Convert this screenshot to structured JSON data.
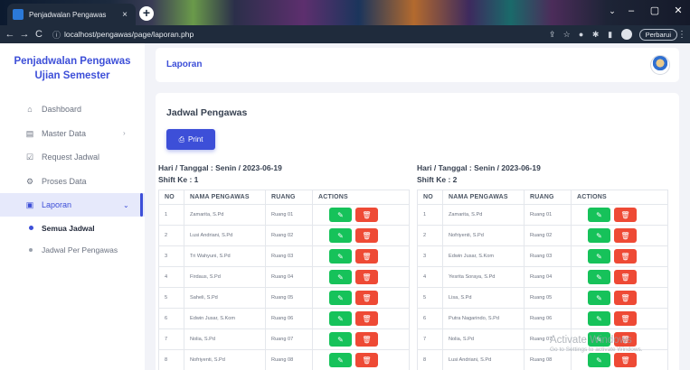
{
  "browser": {
    "tab_title": "Penjadwalan Pengawas",
    "tab_close": "×",
    "new_tab": "+",
    "url": "localhost/pengawas/page/laporan.php",
    "update_label": "Perbarui",
    "window_controls": [
      "⌄",
      "–",
      "▢",
      "✕"
    ]
  },
  "sidebar": {
    "brand": "Penjadwalan Pengawas Ujian Semester",
    "items": [
      {
        "label": "Dashboard",
        "icon": "home-icon"
      },
      {
        "label": "Master Data",
        "icon": "database-icon",
        "chevron": "›"
      },
      {
        "label": "Request Jadwal",
        "icon": "edit-square-icon"
      },
      {
        "label": "Proses Data",
        "icon": "gear-icon"
      },
      {
        "label": "Laporan",
        "icon": "document-icon",
        "chevron": "⌄"
      }
    ],
    "subitems": [
      {
        "label": "Semua Jadwal"
      },
      {
        "label": "Jadwal Per Pengawas"
      }
    ]
  },
  "header": {
    "title": "Laporan"
  },
  "card": {
    "title": "Jadwal Pengawas",
    "print_label": "Print",
    "columns": [
      "NO",
      "NAMA PENGAWAS",
      "RUANG",
      "ACTIONS"
    ],
    "sections": [
      {
        "day_line": "Hari / Tanggal : Senin / 2023-06-19",
        "shift_line": "Shift Ke : 1",
        "rows": [
          [
            "1",
            "Zamarita, S.Pd",
            "Ruang 01"
          ],
          [
            "2",
            "Lusi Andriani, S.Pd",
            "Ruang 02"
          ],
          [
            "3",
            "Tri Wahyuni, S.Pd",
            "Ruang 03"
          ],
          [
            "4",
            "Firdaus, S.Pd",
            "Ruang 04"
          ],
          [
            "5",
            "Saheli, S.Pd",
            "Ruang 05"
          ],
          [
            "6",
            "Edwin Jusar, S.Kom",
            "Ruang 06"
          ],
          [
            "7",
            "Nolia, S.Pd",
            "Ruang 07"
          ],
          [
            "8",
            "Nofriyenti, S.Pd",
            "Ruang 08"
          ]
        ]
      },
      {
        "day_line": "Hari / Tanggal : Senin / 2023-06-19",
        "shift_line": "Shift Ke : 2",
        "rows": [
          [
            "1",
            "Zamarita, S.Pd",
            "Ruang 01"
          ],
          [
            "2",
            "Nofriyenti, S.Pd",
            "Ruang 02"
          ],
          [
            "3",
            "Edwin Jusar, S.Kom",
            "Ruang 03"
          ],
          [
            "4",
            "Yesrita Soraya, S.Pd",
            "Ruang 04"
          ],
          [
            "5",
            "Lisa, S.Pd",
            "Ruang 05"
          ],
          [
            "6",
            "Putra Nagarindo, S.Pd",
            "Ruang 06"
          ],
          [
            "7",
            "Nolia, S.Pd",
            "Ruang 07"
          ],
          [
            "8",
            "Lusi Andriani, S.Pd",
            "Ruang 08"
          ]
        ]
      }
    ]
  },
  "watermark": {
    "line1": "Activate Windows",
    "line2": "Go to Settings to activate Windows."
  },
  "colors": {
    "accent": "#3d4fd8",
    "edit_button": "#16c25a",
    "delete_button": "#ee4a35"
  }
}
